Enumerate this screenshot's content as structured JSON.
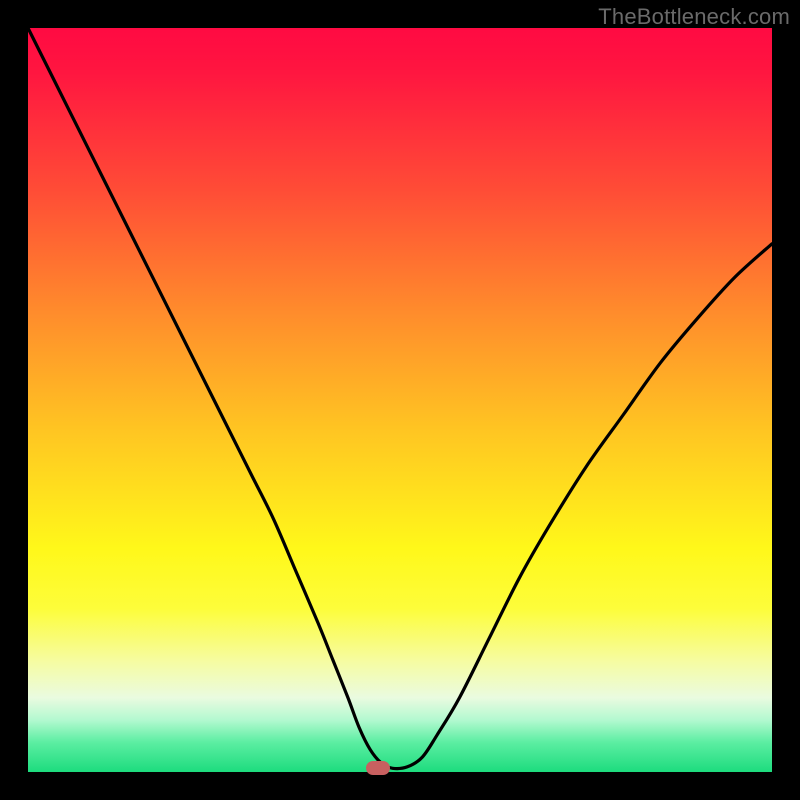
{
  "watermark": "TheBottleneck.com",
  "colors": {
    "frame": "#000000",
    "curve": "#000000",
    "marker": "#c86060"
  },
  "chart_data": {
    "type": "line",
    "title": "",
    "xlabel": "",
    "ylabel": "",
    "xlim": [
      0,
      100
    ],
    "ylim": [
      0,
      100
    ],
    "grid": false,
    "legend": false,
    "series": [
      {
        "name": "bottleneck-curve",
        "x": [
          0,
          3,
          6,
          9,
          12,
          15,
          18,
          21,
          24,
          27,
          30,
          33,
          36,
          39,
          41,
          43,
          44.5,
          46,
          47.5,
          49,
          51,
          53,
          55,
          58,
          62,
          66,
          70,
          75,
          80,
          85,
          90,
          95,
          100
        ],
        "y": [
          100,
          94,
          88,
          82,
          76,
          70,
          64,
          58,
          52,
          46,
          40,
          34,
          27,
          20,
          15,
          10,
          6,
          3,
          1.2,
          0.5,
          0.7,
          2,
          5,
          10,
          18,
          26,
          33,
          41,
          48,
          55,
          61,
          66.5,
          71
        ]
      }
    ],
    "annotations": [
      {
        "name": "min-marker",
        "x": 47,
        "y": 0.6
      }
    ]
  }
}
